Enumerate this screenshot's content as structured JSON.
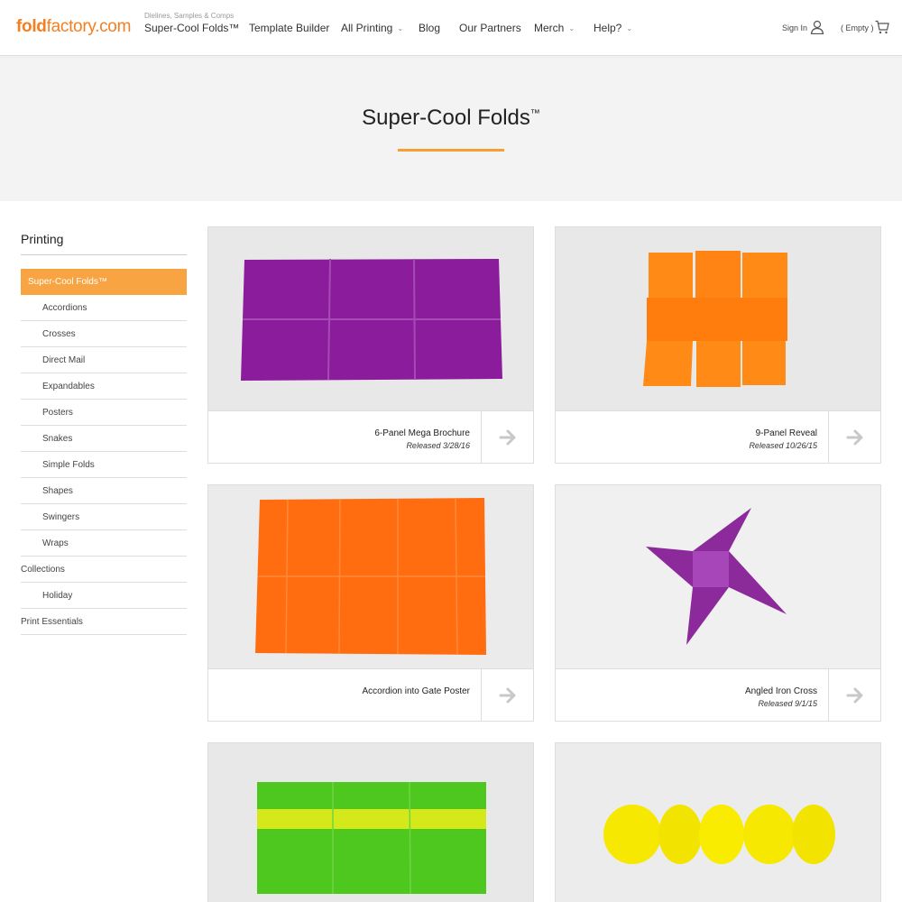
{
  "header": {
    "logo_bold": "fold",
    "logo_rest": "factory.com",
    "nav_kicker": "Dielines, Samples & Comps",
    "nav": [
      {
        "label": "Super-Cool Folds™",
        "has_dropdown": false
      },
      {
        "label": "Template Builder",
        "has_dropdown": false
      },
      {
        "label": "All Printing",
        "has_dropdown": true
      },
      {
        "label": "Blog",
        "has_dropdown": false
      },
      {
        "label": "Our Partners",
        "has_dropdown": false
      },
      {
        "label": "Merch",
        "has_dropdown": true
      },
      {
        "label": "Help?",
        "has_dropdown": true
      }
    ],
    "signin": "Sign In",
    "cart": "( Empty )",
    "icons": {
      "user": "user-icon",
      "cart": "cart-icon",
      "dropdown": "chevron-down-icon"
    }
  },
  "hero": {
    "title": "Super-Cool Folds",
    "title_mark": "™",
    "accent_color": "#f5a034"
  },
  "sidebar": {
    "title": "Printing",
    "items": [
      {
        "label": "Super-Cool Folds™",
        "level": "sub",
        "active": true
      },
      {
        "label": "Accordions",
        "level": "sub",
        "active": false
      },
      {
        "label": "Crosses",
        "level": "sub",
        "active": false
      },
      {
        "label": "Direct Mail",
        "level": "sub",
        "active": false
      },
      {
        "label": "Expandables",
        "level": "sub",
        "active": false
      },
      {
        "label": "Posters",
        "level": "sub",
        "active": false
      },
      {
        "label": "Snakes",
        "level": "sub",
        "active": false
      },
      {
        "label": "Simple Folds",
        "level": "sub",
        "active": false
      },
      {
        "label": "Shapes",
        "level": "sub",
        "active": false
      },
      {
        "label": "Swingers",
        "level": "sub",
        "active": false
      },
      {
        "label": "Wraps",
        "level": "sub",
        "active": false
      },
      {
        "label": "Collections",
        "level": "top",
        "active": false
      },
      {
        "label": "Holiday",
        "level": "sub",
        "active": false
      },
      {
        "label": "Print Essentials",
        "level": "top",
        "active": false
      }
    ],
    "active_color": "#f8a442"
  },
  "products": [
    {
      "title": "6-Panel Mega Brochure",
      "date": "Released 3/28/16",
      "color": "#8e1a9e"
    },
    {
      "title": "9-Panel Reveal",
      "date": "Released 10/26/15",
      "color": "#ff7f0e"
    },
    {
      "title": "Accordion into Gate Poster",
      "date": "",
      "color": "#ff6e12"
    },
    {
      "title": "Angled Iron Cross",
      "date": "Released 9/1/15",
      "color": "#8a2a9a"
    },
    {
      "title": "",
      "date": "",
      "color": "#4cc61e"
    },
    {
      "title": "",
      "date": "",
      "color": "#f5e600"
    }
  ]
}
